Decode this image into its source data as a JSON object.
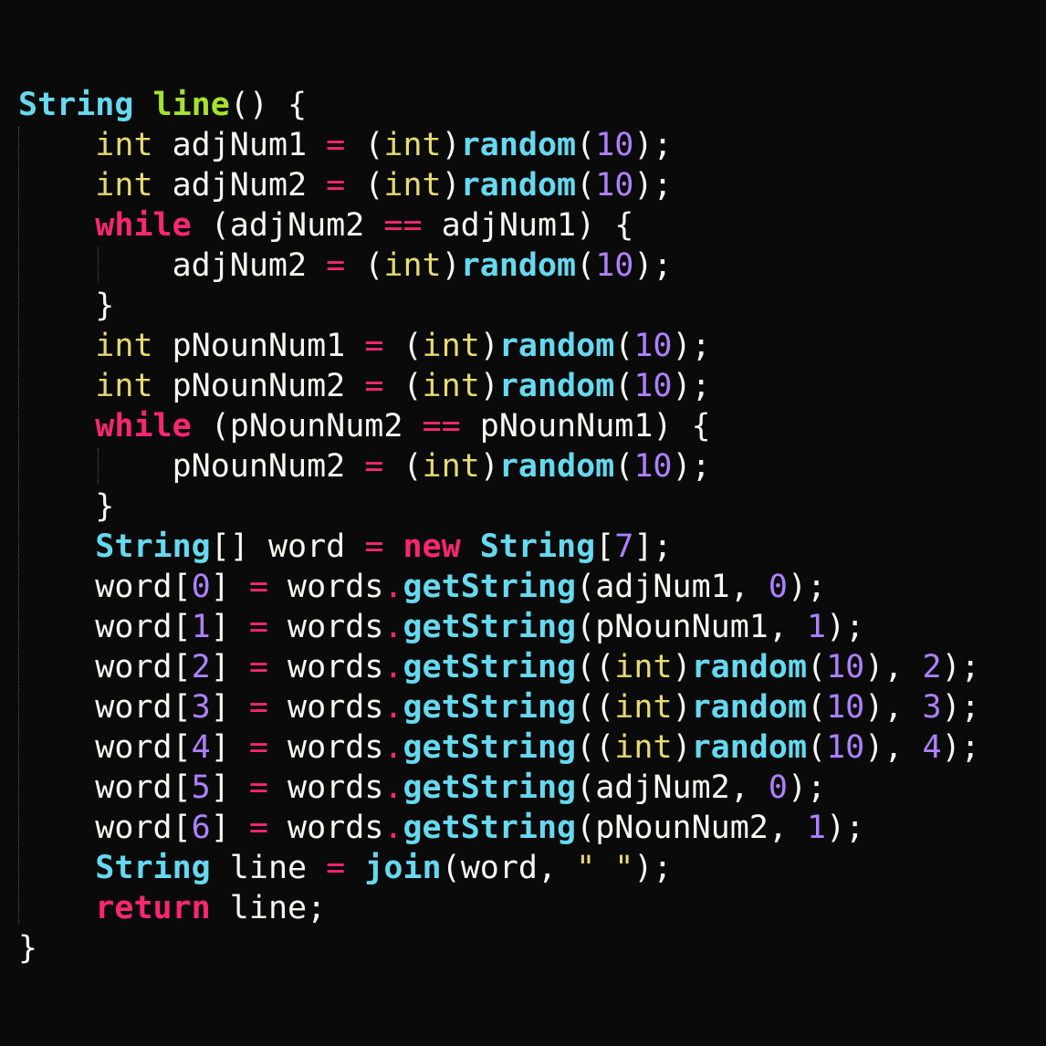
{
  "colors": {
    "background": "#0a0a0a",
    "plain": "#f8f8f2",
    "type": "#66d9ef",
    "keyword": "#f92672",
    "primitive": "#e6db74",
    "number": "#ae81ff",
    "function": "#66d9ef",
    "method": "#66d9ef",
    "string": "#e6db74",
    "operator": "#f92672",
    "decl": "#a6e22e"
  },
  "code_lines": [
    [
      {
        "t": "String",
        "k": "type"
      },
      {
        "t": " ",
        "k": "plain"
      },
      {
        "t": "line",
        "k": "decl"
      },
      {
        "t": "() {",
        "k": "plain"
      }
    ],
    [
      {
        "t": "    ",
        "k": "plain"
      },
      {
        "t": "int",
        "k": "primitive"
      },
      {
        "t": " adjNum1 ",
        "k": "plain"
      },
      {
        "t": "=",
        "k": "operator"
      },
      {
        "t": " (",
        "k": "plain"
      },
      {
        "t": "int",
        "k": "primitive"
      },
      {
        "t": ")",
        "k": "plain"
      },
      {
        "t": "random",
        "k": "function"
      },
      {
        "t": "(",
        "k": "plain"
      },
      {
        "t": "10",
        "k": "number"
      },
      {
        "t": ");",
        "k": "plain"
      }
    ],
    [
      {
        "t": "    ",
        "k": "plain"
      },
      {
        "t": "int",
        "k": "primitive"
      },
      {
        "t": " adjNum2 ",
        "k": "plain"
      },
      {
        "t": "=",
        "k": "operator"
      },
      {
        "t": " (",
        "k": "plain"
      },
      {
        "t": "int",
        "k": "primitive"
      },
      {
        "t": ")",
        "k": "plain"
      },
      {
        "t": "random",
        "k": "function"
      },
      {
        "t": "(",
        "k": "plain"
      },
      {
        "t": "10",
        "k": "number"
      },
      {
        "t": ");",
        "k": "plain"
      }
    ],
    [
      {
        "t": "    ",
        "k": "plain"
      },
      {
        "t": "while",
        "k": "keyword"
      },
      {
        "t": " (adjNum2 ",
        "k": "plain"
      },
      {
        "t": "==",
        "k": "operator"
      },
      {
        "t": " adjNum1) {",
        "k": "plain"
      }
    ],
    [
      {
        "t": "        adjNum2 ",
        "k": "plain"
      },
      {
        "t": "=",
        "k": "operator"
      },
      {
        "t": " (",
        "k": "plain"
      },
      {
        "t": "int",
        "k": "primitive"
      },
      {
        "t": ")",
        "k": "plain"
      },
      {
        "t": "random",
        "k": "function"
      },
      {
        "t": "(",
        "k": "plain"
      },
      {
        "t": "10",
        "k": "number"
      },
      {
        "t": ");",
        "k": "plain"
      }
    ],
    [
      {
        "t": "    }",
        "k": "plain"
      }
    ],
    [
      {
        "t": "    ",
        "k": "plain"
      },
      {
        "t": "int",
        "k": "primitive"
      },
      {
        "t": " pNounNum1 ",
        "k": "plain"
      },
      {
        "t": "=",
        "k": "operator"
      },
      {
        "t": " (",
        "k": "plain"
      },
      {
        "t": "int",
        "k": "primitive"
      },
      {
        "t": ")",
        "k": "plain"
      },
      {
        "t": "random",
        "k": "function"
      },
      {
        "t": "(",
        "k": "plain"
      },
      {
        "t": "10",
        "k": "number"
      },
      {
        "t": ");",
        "k": "plain"
      }
    ],
    [
      {
        "t": "    ",
        "k": "plain"
      },
      {
        "t": "int",
        "k": "primitive"
      },
      {
        "t": " pNounNum2 ",
        "k": "plain"
      },
      {
        "t": "=",
        "k": "operator"
      },
      {
        "t": " (",
        "k": "plain"
      },
      {
        "t": "int",
        "k": "primitive"
      },
      {
        "t": ")",
        "k": "plain"
      },
      {
        "t": "random",
        "k": "function"
      },
      {
        "t": "(",
        "k": "plain"
      },
      {
        "t": "10",
        "k": "number"
      },
      {
        "t": ");",
        "k": "plain"
      }
    ],
    [
      {
        "t": "    ",
        "k": "plain"
      },
      {
        "t": "while",
        "k": "keyword"
      },
      {
        "t": " (pNounNum2 ",
        "k": "plain"
      },
      {
        "t": "==",
        "k": "operator"
      },
      {
        "t": " pNounNum1) {",
        "k": "plain"
      }
    ],
    [
      {
        "t": "        pNounNum2 ",
        "k": "plain"
      },
      {
        "t": "=",
        "k": "operator"
      },
      {
        "t": " (",
        "k": "plain"
      },
      {
        "t": "int",
        "k": "primitive"
      },
      {
        "t": ")",
        "k": "plain"
      },
      {
        "t": "random",
        "k": "function"
      },
      {
        "t": "(",
        "k": "plain"
      },
      {
        "t": "10",
        "k": "number"
      },
      {
        "t": ");",
        "k": "plain"
      }
    ],
    [
      {
        "t": "    }",
        "k": "plain"
      }
    ],
    [
      {
        "t": "    ",
        "k": "plain"
      },
      {
        "t": "String",
        "k": "type"
      },
      {
        "t": "[] word ",
        "k": "plain"
      },
      {
        "t": "=",
        "k": "operator"
      },
      {
        "t": " ",
        "k": "plain"
      },
      {
        "t": "new",
        "k": "keyword"
      },
      {
        "t": " ",
        "k": "plain"
      },
      {
        "t": "String",
        "k": "type"
      },
      {
        "t": "[",
        "k": "plain"
      },
      {
        "t": "7",
        "k": "number"
      },
      {
        "t": "];",
        "k": "plain"
      }
    ],
    [
      {
        "t": "    word[",
        "k": "plain"
      },
      {
        "t": "0",
        "k": "number"
      },
      {
        "t": "] ",
        "k": "plain"
      },
      {
        "t": "=",
        "k": "operator"
      },
      {
        "t": " words",
        "k": "plain"
      },
      {
        "t": ".",
        "k": "operator"
      },
      {
        "t": "getString",
        "k": "method"
      },
      {
        "t": "(adjNum1, ",
        "k": "plain"
      },
      {
        "t": "0",
        "k": "number"
      },
      {
        "t": ");",
        "k": "plain"
      }
    ],
    [
      {
        "t": "    word[",
        "k": "plain"
      },
      {
        "t": "1",
        "k": "number"
      },
      {
        "t": "] ",
        "k": "plain"
      },
      {
        "t": "=",
        "k": "operator"
      },
      {
        "t": " words",
        "k": "plain"
      },
      {
        "t": ".",
        "k": "operator"
      },
      {
        "t": "getString",
        "k": "method"
      },
      {
        "t": "(pNounNum1, ",
        "k": "plain"
      },
      {
        "t": "1",
        "k": "number"
      },
      {
        "t": ");",
        "k": "plain"
      }
    ],
    [
      {
        "t": "    word[",
        "k": "plain"
      },
      {
        "t": "2",
        "k": "number"
      },
      {
        "t": "] ",
        "k": "plain"
      },
      {
        "t": "=",
        "k": "operator"
      },
      {
        "t": " words",
        "k": "plain"
      },
      {
        "t": ".",
        "k": "operator"
      },
      {
        "t": "getString",
        "k": "method"
      },
      {
        "t": "((",
        "k": "plain"
      },
      {
        "t": "int",
        "k": "primitive"
      },
      {
        "t": ")",
        "k": "plain"
      },
      {
        "t": "random",
        "k": "function"
      },
      {
        "t": "(",
        "k": "plain"
      },
      {
        "t": "10",
        "k": "number"
      },
      {
        "t": "), ",
        "k": "plain"
      },
      {
        "t": "2",
        "k": "number"
      },
      {
        "t": ");",
        "k": "plain"
      }
    ],
    [
      {
        "t": "    word[",
        "k": "plain"
      },
      {
        "t": "3",
        "k": "number"
      },
      {
        "t": "] ",
        "k": "plain"
      },
      {
        "t": "=",
        "k": "operator"
      },
      {
        "t": " words",
        "k": "plain"
      },
      {
        "t": ".",
        "k": "operator"
      },
      {
        "t": "getString",
        "k": "method"
      },
      {
        "t": "((",
        "k": "plain"
      },
      {
        "t": "int",
        "k": "primitive"
      },
      {
        "t": ")",
        "k": "plain"
      },
      {
        "t": "random",
        "k": "function"
      },
      {
        "t": "(",
        "k": "plain"
      },
      {
        "t": "10",
        "k": "number"
      },
      {
        "t": "), ",
        "k": "plain"
      },
      {
        "t": "3",
        "k": "number"
      },
      {
        "t": ");",
        "k": "plain"
      }
    ],
    [
      {
        "t": "    word[",
        "k": "plain"
      },
      {
        "t": "4",
        "k": "number"
      },
      {
        "t": "] ",
        "k": "plain"
      },
      {
        "t": "=",
        "k": "operator"
      },
      {
        "t": " words",
        "k": "plain"
      },
      {
        "t": ".",
        "k": "operator"
      },
      {
        "t": "getString",
        "k": "method"
      },
      {
        "t": "((",
        "k": "plain"
      },
      {
        "t": "int",
        "k": "primitive"
      },
      {
        "t": ")",
        "k": "plain"
      },
      {
        "t": "random",
        "k": "function"
      },
      {
        "t": "(",
        "k": "plain"
      },
      {
        "t": "10",
        "k": "number"
      },
      {
        "t": "), ",
        "k": "plain"
      },
      {
        "t": "4",
        "k": "number"
      },
      {
        "t": ");",
        "k": "plain"
      }
    ],
    [
      {
        "t": "    word[",
        "k": "plain"
      },
      {
        "t": "5",
        "k": "number"
      },
      {
        "t": "] ",
        "k": "plain"
      },
      {
        "t": "=",
        "k": "operator"
      },
      {
        "t": " words",
        "k": "plain"
      },
      {
        "t": ".",
        "k": "operator"
      },
      {
        "t": "getString",
        "k": "method"
      },
      {
        "t": "(adjNum2, ",
        "k": "plain"
      },
      {
        "t": "0",
        "k": "number"
      },
      {
        "t": ");",
        "k": "plain"
      }
    ],
    [
      {
        "t": "    word[",
        "k": "plain"
      },
      {
        "t": "6",
        "k": "number"
      },
      {
        "t": "] ",
        "k": "plain"
      },
      {
        "t": "=",
        "k": "operator"
      },
      {
        "t": " words",
        "k": "plain"
      },
      {
        "t": ".",
        "k": "operator"
      },
      {
        "t": "getString",
        "k": "method"
      },
      {
        "t": "(pNounNum2, ",
        "k": "plain"
      },
      {
        "t": "1",
        "k": "number"
      },
      {
        "t": ");",
        "k": "plain"
      }
    ],
    [
      {
        "t": "    ",
        "k": "plain"
      },
      {
        "t": "String",
        "k": "type"
      },
      {
        "t": " line ",
        "k": "plain"
      },
      {
        "t": "=",
        "k": "operator"
      },
      {
        "t": " ",
        "k": "plain"
      },
      {
        "t": "join",
        "k": "function"
      },
      {
        "t": "(word, ",
        "k": "plain"
      },
      {
        "t": "\" \"",
        "k": "string"
      },
      {
        "t": ");",
        "k": "plain"
      }
    ],
    [
      {
        "t": "    ",
        "k": "plain"
      },
      {
        "t": "return",
        "k": "keyword"
      },
      {
        "t": " line;",
        "k": "plain"
      }
    ],
    [
      {
        "t": "}",
        "k": "plain"
      }
    ]
  ]
}
